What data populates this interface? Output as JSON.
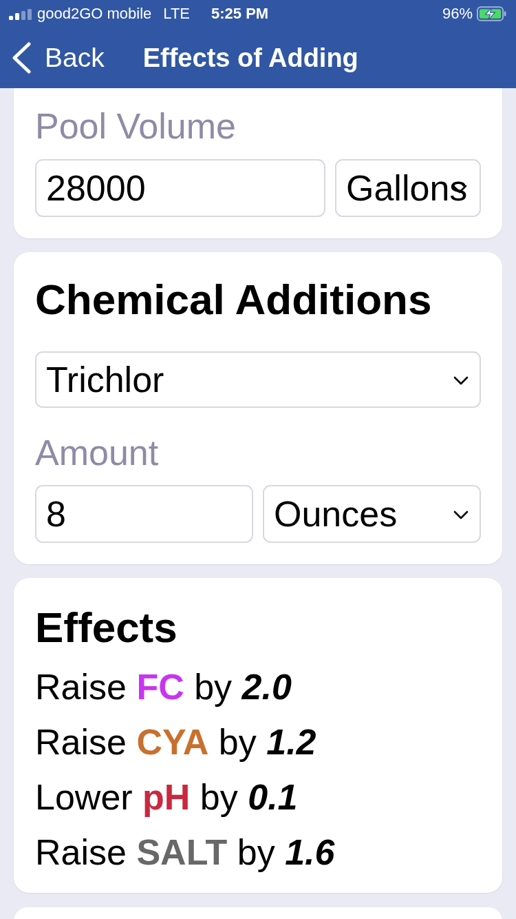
{
  "status_bar": {
    "carrier": "good2GO mobile",
    "network": "LTE",
    "time": "5:25 PM",
    "battery": "96%"
  },
  "nav_bar": {
    "back": "Back",
    "title": "Effects of Adding"
  },
  "pool_volume": {
    "label": "Pool Volume",
    "value": "28000",
    "unit": "Gallons"
  },
  "chemical_additions": {
    "title": "Chemical Additions",
    "chemical": "Trichlor",
    "amount_label": "Amount",
    "amount": "8",
    "unit": "Ounces"
  },
  "effects": {
    "title": "Effects",
    "items": [
      {
        "action": "Raise",
        "target": "FC",
        "color": "#c735f0",
        "connector": "by",
        "amount": "2.0"
      },
      {
        "action": "Raise",
        "target": "CYA",
        "color": "#c8702e",
        "connector": "by",
        "amount": "1.2"
      },
      {
        "action": "Lower",
        "target": "pH",
        "color": "#c9283f",
        "connector": "by",
        "amount": "0.1"
      },
      {
        "action": "Raise",
        "target": "SALT",
        "color": "#686868",
        "connector": "by",
        "amount": "1.6"
      }
    ]
  }
}
